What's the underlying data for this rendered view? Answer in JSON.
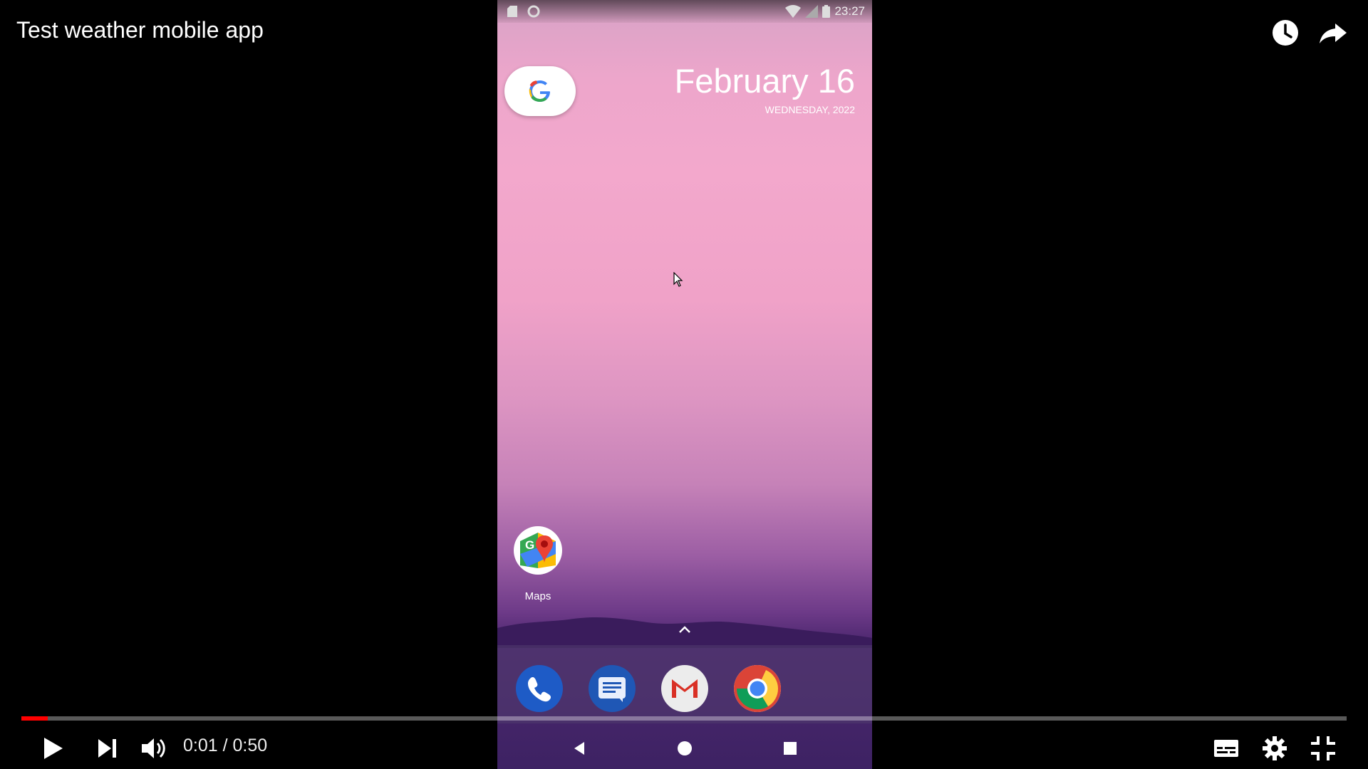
{
  "video": {
    "title": "Test weather mobile app",
    "current_time": "0:01",
    "time_separator": "/",
    "duration": "0:50",
    "progress_fraction": 0.02
  },
  "top_actions": {
    "watch_later_icon": "clock-icon",
    "share_icon": "share-arrow-icon"
  },
  "phone": {
    "status_time": "23:27",
    "date_main": "February 16",
    "date_sub": "WEDNESDAY, 2022",
    "home_apps": [
      {
        "label": "Maps",
        "icon": "maps-icon"
      }
    ],
    "dock_apps": [
      {
        "icon": "phone-icon"
      },
      {
        "icon": "messages-icon"
      },
      {
        "icon": "gmail-icon"
      },
      {
        "icon": "chrome-icon"
      }
    ],
    "nav": [
      "back-icon",
      "home-icon",
      "recents-icon"
    ]
  },
  "controls": {
    "left": [
      "play-icon",
      "next-icon",
      "volume-icon"
    ],
    "right": [
      "subtitles-icon",
      "settings-icon",
      "exit-fullscreen-icon"
    ]
  },
  "colors": {
    "progress": "#ff0000",
    "background": "#000000"
  }
}
